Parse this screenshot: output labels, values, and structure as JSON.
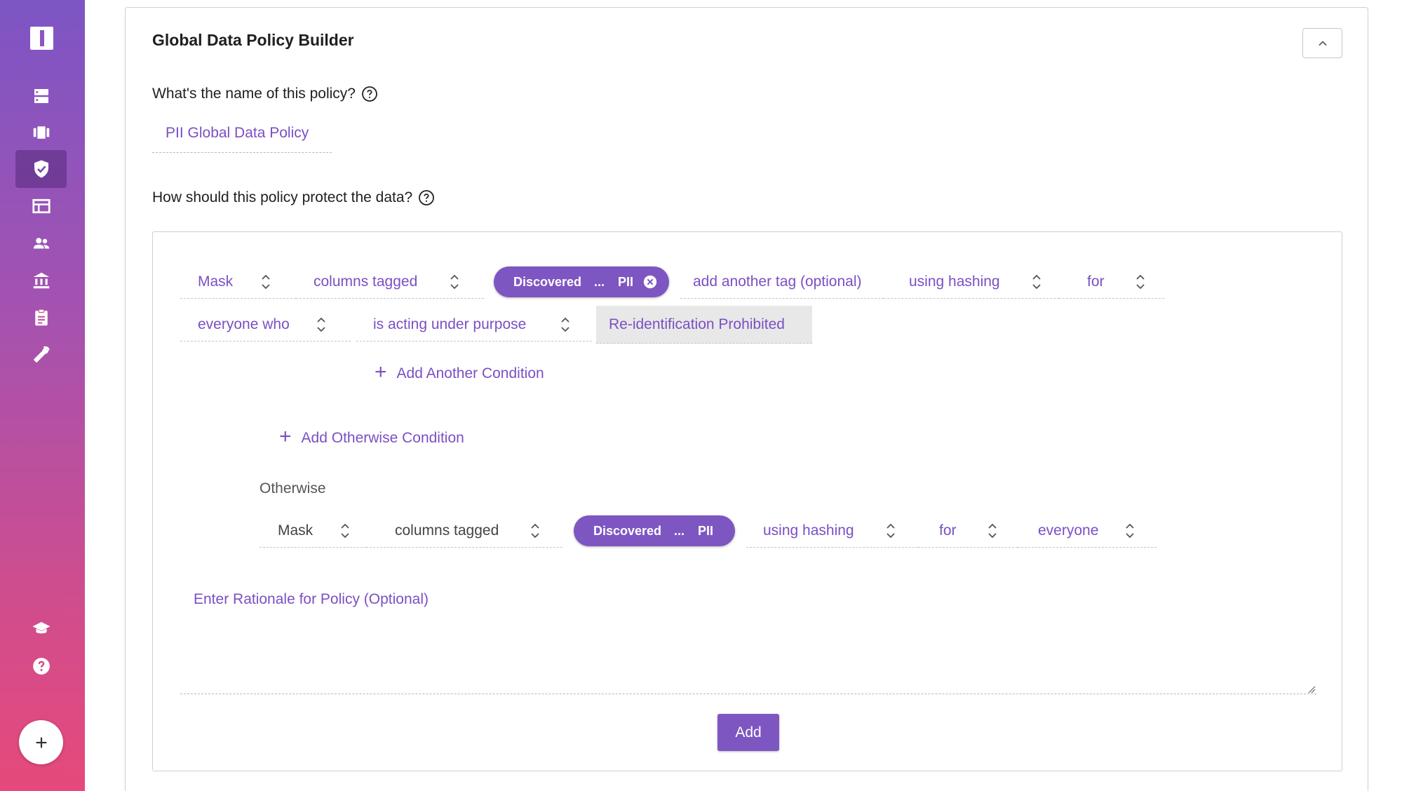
{
  "sidebar": {
    "items": [
      {
        "icon": "storage-icon"
      },
      {
        "icon": "projects-icon"
      },
      {
        "icon": "policy-shield-icon",
        "active": true
      },
      {
        "icon": "table-icon"
      },
      {
        "icon": "people-icon"
      },
      {
        "icon": "bank-icon"
      },
      {
        "icon": "clipboard-icon"
      },
      {
        "icon": "wrench-icon"
      },
      {
        "icon": "school-icon"
      },
      {
        "icon": "help-icon"
      }
    ],
    "add_label": "+"
  },
  "panel": {
    "title": "Global Data Policy Builder"
  },
  "name_question": "What's the name of this policy?",
  "policy_name": "PII Global Data Policy",
  "protect_question": "How should this policy protect the data?",
  "rule": {
    "action": "Mask",
    "target": "columns tagged",
    "tag_chip": {
      "left": "Discovered",
      "mid": "...",
      "right": "PII"
    },
    "add_tag": "add another tag (optional)",
    "method": "using hashing",
    "for": "for",
    "who": "everyone who",
    "condition": "is acting under purpose",
    "purpose": "Re-identification Prohibited",
    "add_condition": "Add Another Condition"
  },
  "add_otherwise": "Add Otherwise Condition",
  "otherwise": {
    "label": "Otherwise",
    "action": "Mask",
    "target": "columns tagged",
    "tag_chip": {
      "left": "Discovered",
      "mid": "...",
      "right": "PII"
    },
    "method": "using hashing",
    "for": "for",
    "who": "everyone"
  },
  "rationale_placeholder": "Enter Rationale for Policy (Optional)",
  "add_button": "Add",
  "colors": {
    "accent": "#7e56c2",
    "sidebar_top": "#7d55c4",
    "sidebar_bottom": "#e6497b"
  }
}
